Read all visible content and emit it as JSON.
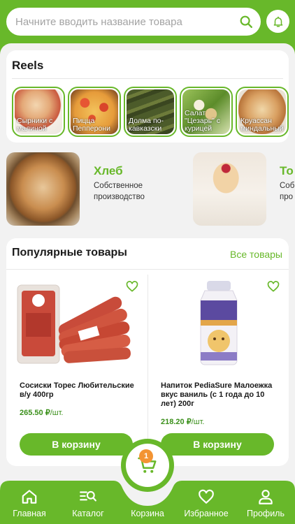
{
  "search": {
    "placeholder": "Начните вводить название товара"
  },
  "reels": {
    "title": "Reels",
    "items": [
      {
        "label": "Сырники с малиной"
      },
      {
        "label": "Пицца Пепперони"
      },
      {
        "label": "Долма по-кавказски"
      },
      {
        "label": "Салат \"Цезарь\" с курицей"
      },
      {
        "label": "Круассан миндальный"
      }
    ]
  },
  "categories": [
    {
      "title": "Хлеб",
      "subtitle": "Собственное производство"
    },
    {
      "title": "То",
      "subtitle": "Соб про"
    }
  ],
  "popular": {
    "title": "Популярные товары",
    "all_link": "Все товары",
    "products": [
      {
        "name": "Сосиски Торес Любительские в/у 400гр",
        "price": "265.50 ₽",
        "unit": "/шт.",
        "button": "В корзину"
      },
      {
        "name": "Напиток PediaSure Малоежка вкус ваниль (с 1 года до 10 лет) 200г",
        "price": "218.20 ₽",
        "unit": "/шт.",
        "button": "В корзину"
      }
    ]
  },
  "cart": {
    "count": "1"
  },
  "nav": [
    {
      "label": "Главная",
      "icon": "home-icon"
    },
    {
      "label": "Каталог",
      "icon": "catalog-search-icon"
    },
    {
      "label": "Корзина",
      "icon": "cart-icon"
    },
    {
      "label": "Избранное",
      "icon": "heart-icon"
    },
    {
      "label": "Профиль",
      "icon": "user-icon"
    }
  ],
  "colors": {
    "accent": "#68b82a",
    "badge": "#f39433",
    "price": "#3a8f1a"
  }
}
